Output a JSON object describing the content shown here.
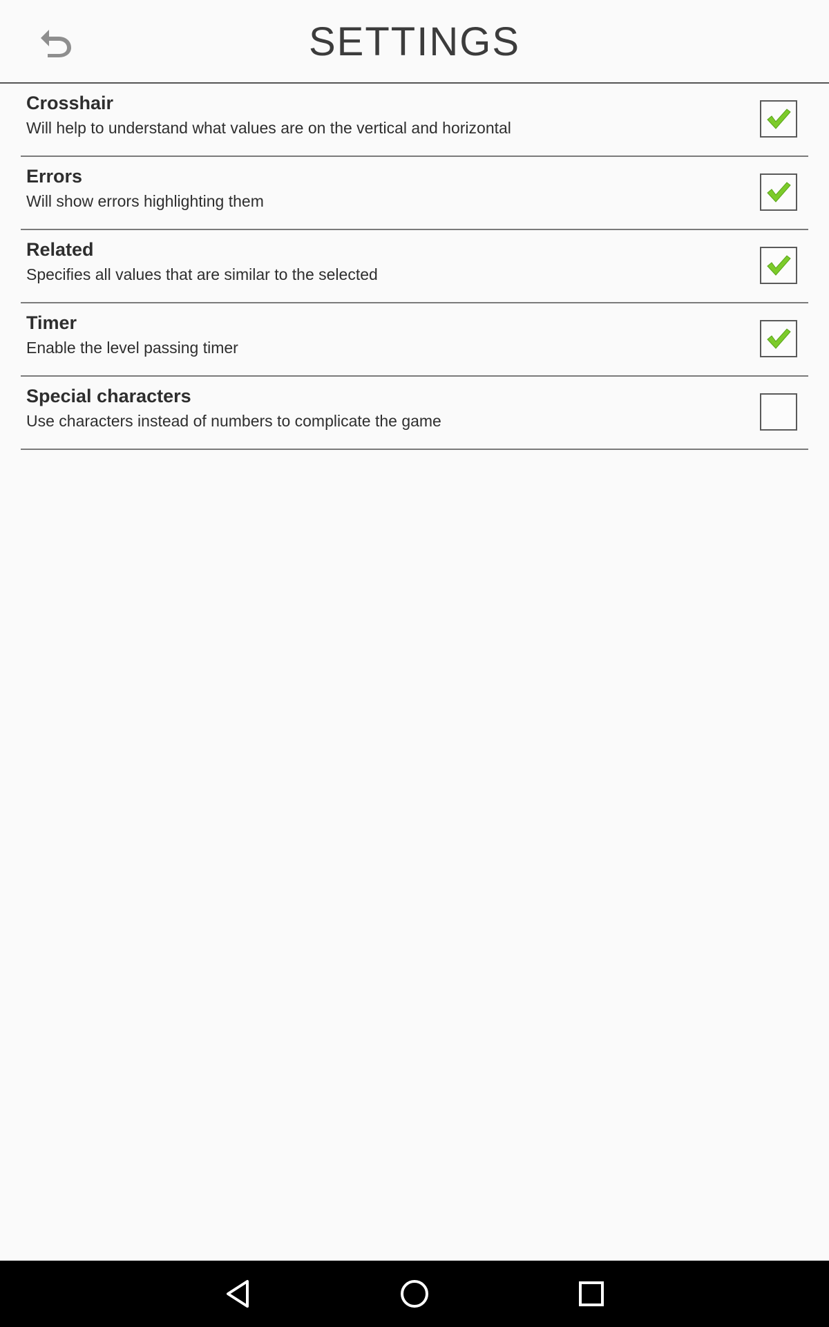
{
  "header": {
    "title": "SETTINGS",
    "back_icon": "undo-arrow-icon"
  },
  "settings": [
    {
      "title": "Crosshair",
      "description": "Will help to understand what values are on the vertical and horizontal",
      "checked": true
    },
    {
      "title": "Errors",
      "description": "Will show errors highlighting them",
      "checked": true
    },
    {
      "title": "Related",
      "description": "Specifies all values that are similar to the selected",
      "checked": true
    },
    {
      "title": "Timer",
      "description": "Enable the level passing timer",
      "checked": true
    },
    {
      "title": "Special characters",
      "description": "Use characters instead of numbers to complicate the game",
      "checked": false
    }
  ],
  "navbar": {
    "back_icon": "triangle-back-icon",
    "home_icon": "circle-home-icon",
    "recents_icon": "square-recents-icon"
  },
  "colors": {
    "check_green": "#7ccb2a",
    "background": "#fafafa",
    "text": "#2e2e2e"
  }
}
